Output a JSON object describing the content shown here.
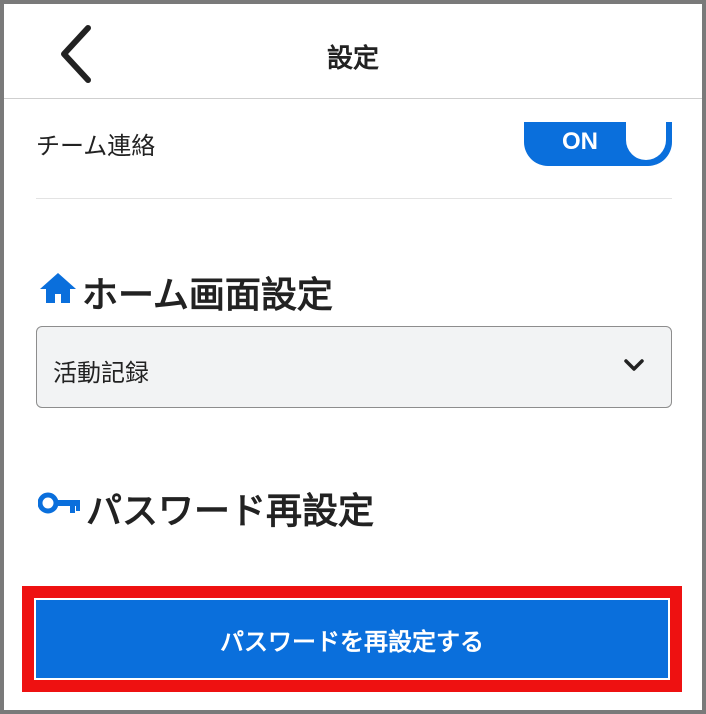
{
  "header": {
    "title": "設定"
  },
  "notifications": {
    "team_contact_label": "チーム連絡",
    "team_contact_toggle": "ON"
  },
  "home_screen": {
    "title": "ホーム画面設定",
    "selected": "活動記録"
  },
  "password": {
    "title": "パスワード再設定",
    "button_label": "パスワードを再設定する"
  },
  "icons": {
    "back": "chevron-left-icon",
    "home": "home-icon",
    "key": "key-icon",
    "dropdown": "chevron-down-icon"
  },
  "colors": {
    "accent": "#0a6fdc",
    "highlight": "#ee1111"
  }
}
